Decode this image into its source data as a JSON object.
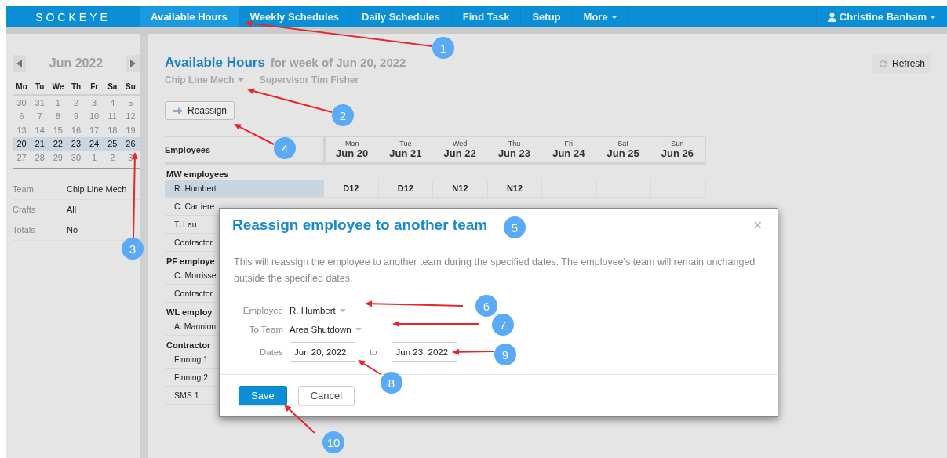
{
  "nav": {
    "logo": "SOCKEYE",
    "items": [
      {
        "label": "Available Hours",
        "selected": true,
        "dropdown": false
      },
      {
        "label": "Weekly Schedules",
        "selected": false,
        "dropdown": false
      },
      {
        "label": "Daily Schedules",
        "selected": false,
        "dropdown": false
      },
      {
        "label": "Find Task",
        "selected": false,
        "dropdown": false
      },
      {
        "label": "Setup",
        "selected": false,
        "dropdown": false
      },
      {
        "label": "More",
        "selected": false,
        "dropdown": true
      }
    ],
    "user": "Christine Banham"
  },
  "calendar": {
    "month": "Jun 2022",
    "weekdays": [
      "Mo",
      "Tu",
      "We",
      "Th",
      "Fr",
      "Sa",
      "Su"
    ],
    "weeks": [
      {
        "selected": false,
        "days": [
          "30",
          "31",
          "1",
          "2",
          "3",
          "4",
          "5"
        ]
      },
      {
        "selected": false,
        "days": [
          "6",
          "7",
          "8",
          "9",
          "10",
          "11",
          "12"
        ]
      },
      {
        "selected": false,
        "days": [
          "13",
          "14",
          "15",
          "16",
          "17",
          "18",
          "19"
        ]
      },
      {
        "selected": true,
        "days": [
          "20",
          "21",
          "22",
          "23",
          "24",
          "25",
          "26"
        ]
      },
      {
        "selected": false,
        "days": [
          "27",
          "28",
          "29",
          "30",
          "1",
          "2",
          "3"
        ]
      }
    ]
  },
  "filters": [
    {
      "label": "Team",
      "value": "Chip Line Mech"
    },
    {
      "label": "Crafts",
      "value": "All"
    },
    {
      "label": "Totals",
      "value": "No"
    }
  ],
  "header": {
    "title": "Available Hours",
    "subtitle": "for week of Jun 20, 2022",
    "team": "Chip Line Mech",
    "supervisor": "Supervisor Tim Fisher"
  },
  "refresh": "Refresh",
  "reassign": "Reassign",
  "table": {
    "employees_heading": "Employees",
    "days": [
      {
        "weekday": "Mon",
        "date": "Jun 20"
      },
      {
        "weekday": "Tue",
        "date": "Jun 21"
      },
      {
        "weekday": "Wed",
        "date": "Jun 22"
      },
      {
        "weekday": "Thu",
        "date": "Jun 23"
      },
      {
        "weekday": "Fri",
        "date": "Jun 24"
      },
      {
        "weekday": "Sat",
        "date": "Jun 25"
      },
      {
        "weekday": "Sun",
        "date": "Jun 26"
      }
    ],
    "groups": [
      {
        "name": "MW employees",
        "rows": [
          {
            "name": "R. Humbert",
            "selected": true,
            "shifts": {
              "mon": "D12",
              "tue": "D12",
              "wed": "N12",
              "thu": "N12"
            }
          },
          {
            "name": "C. Carriere",
            "selected": false
          },
          {
            "name": "T. Lau",
            "selected": false
          },
          {
            "name": "Contractor",
            "selected": false
          }
        ]
      },
      {
        "name": "PF employe",
        "rows": [
          {
            "name": "C. Morrisse",
            "selected": false
          },
          {
            "name": "Contractor",
            "selected": false
          }
        ]
      },
      {
        "name": "WL employ",
        "rows": [
          {
            "name": "A. Mannion",
            "selected": false
          }
        ]
      },
      {
        "name": "Contractor",
        "rows": [
          {
            "name": "Finning 1",
            "selected": false
          },
          {
            "name": "Finning 2",
            "selected": false
          },
          {
            "name": "SMS 1",
            "selected": false
          }
        ]
      }
    ]
  },
  "dialog": {
    "title": "Reassign employee to another team",
    "close": "×",
    "description": "This will reassign the employee to another team during the specified dates. The employee's team will remain unchanged outside the specified dates.",
    "fields": [
      {
        "kind": "select",
        "label": "Employee",
        "value": "R. Humbert"
      },
      {
        "kind": "select",
        "label": "To Team",
        "value": "Area Shutdown"
      },
      {
        "kind": "range",
        "label": "Dates",
        "from": "Jun 20, 2022",
        "separator": "to",
        "to": "Jun 23, 2022"
      }
    ],
    "buttons": [
      {
        "label": "Save",
        "primary": true
      },
      {
        "label": "Cancel",
        "primary": false
      }
    ]
  },
  "annotations": [
    {
      "number": "1",
      "arrow": true
    },
    {
      "number": "2",
      "arrow": true
    },
    {
      "number": "3",
      "arrow": true
    },
    {
      "number": "4",
      "arrow": true
    },
    {
      "number": "5",
      "arrow": false
    },
    {
      "number": "6",
      "arrow": true
    },
    {
      "number": "7",
      "arrow": true
    },
    {
      "number": "8",
      "arrow": true
    },
    {
      "number": "9",
      "arrow": true
    },
    {
      "number": "10",
      "arrow": true
    }
  ]
}
